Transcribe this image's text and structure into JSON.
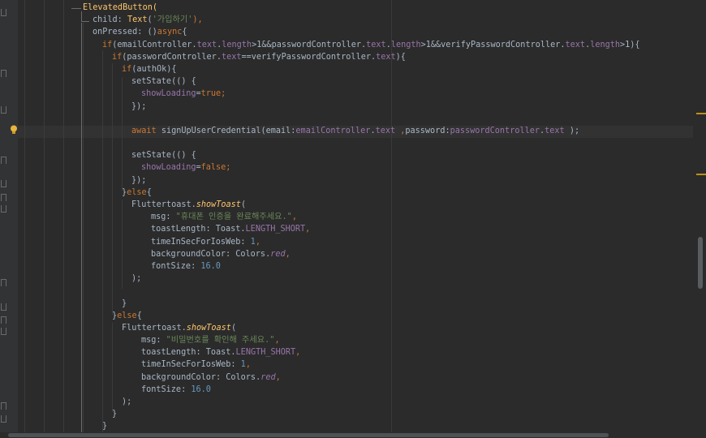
{
  "editor": {
    "lines": [
      [
        {
          "t": "ElevatedButton(",
          "c": "cls"
        }
      ],
      [
        {
          "t": "child",
          "c": "plain"
        },
        {
          "t": ": ",
          "c": "plain"
        },
        {
          "t": "Text",
          "c": "cls"
        },
        {
          "t": "(",
          "c": "plain"
        },
        {
          "t": "'가입하기'",
          "c": "str"
        },
        {
          "t": "),",
          "c": "kw"
        }
      ],
      [
        {
          "t": "onPressed: ()",
          "c": "plain"
        },
        {
          "t": "async",
          "c": "kw"
        },
        {
          "t": "{",
          "c": "plain"
        }
      ],
      [
        {
          "t": "if",
          "c": "kw"
        },
        {
          "t": "(emailController.",
          "c": "plain"
        },
        {
          "t": "text",
          "c": "fld"
        },
        {
          "t": ".",
          "c": "plain"
        },
        {
          "t": "length",
          "c": "fld"
        },
        {
          "t": ">1&&passwordController.",
          "c": "plain"
        },
        {
          "t": "text",
          "c": "fld"
        },
        {
          "t": ".",
          "c": "plain"
        },
        {
          "t": "length",
          "c": "fld"
        },
        {
          "t": ">1&&verifyPasswordController.",
          "c": "plain"
        },
        {
          "t": "text",
          "c": "fld"
        },
        {
          "t": ".",
          "c": "plain"
        },
        {
          "t": "length",
          "c": "fld"
        },
        {
          "t": ">1){",
          "c": "plain"
        }
      ],
      [
        {
          "t": "if",
          "c": "kw"
        },
        {
          "t": "(passwordController.",
          "c": "plain"
        },
        {
          "t": "text",
          "c": "fld"
        },
        {
          "t": "==verifyPasswordController.",
          "c": "plain"
        },
        {
          "t": "text",
          "c": "fld"
        },
        {
          "t": "){",
          "c": "plain"
        }
      ],
      [
        {
          "t": "if",
          "c": "kw"
        },
        {
          "t": "(authOk){",
          "c": "plain"
        }
      ],
      [
        {
          "t": "setState(() {",
          "c": "plain"
        }
      ],
      [
        {
          "t": "showLoading",
          "c": "fld"
        },
        {
          "t": "=",
          "c": "plain"
        },
        {
          "t": "true",
          "c": "kw"
        },
        {
          "t": ";",
          "c": "kw"
        }
      ],
      [
        {
          "t": "});",
          "c": "plain"
        }
      ],
      [],
      [
        {
          "t": "await ",
          "c": "kw"
        },
        {
          "t": "signUpUserCredential(email:",
          "c": "plain"
        },
        {
          "t": "emailController",
          "c": "fld"
        },
        {
          "t": ".",
          "c": "plain"
        },
        {
          "t": "text ",
          "c": "fld"
        },
        {
          "t": ",",
          "c": "kw"
        },
        {
          "t": "password:",
          "c": "plain"
        },
        {
          "t": "passwordController",
          "c": "fld"
        },
        {
          "t": ".",
          "c": "plain"
        },
        {
          "t": "text ",
          "c": "fld"
        },
        {
          "t": ");",
          "c": "plain"
        }
      ],
      [],
      [
        {
          "t": "setState(() {",
          "c": "plain"
        }
      ],
      [
        {
          "t": "showLoading",
          "c": "fld"
        },
        {
          "t": "=",
          "c": "plain"
        },
        {
          "t": "false",
          "c": "kw"
        },
        {
          "t": ";",
          "c": "kw"
        }
      ],
      [
        {
          "t": "});",
          "c": "plain"
        }
      ],
      [
        {
          "t": "}",
          "c": "plain"
        },
        {
          "t": "else",
          "c": "kw"
        },
        {
          "t": "{",
          "c": "plain"
        }
      ],
      [
        {
          "t": "Fluttertoast.",
          "c": "plain"
        },
        {
          "t": "showToast",
          "c": "itm"
        },
        {
          "t": "(",
          "c": "plain"
        }
      ],
      [
        {
          "t": "msg: ",
          "c": "plain"
        },
        {
          "t": "\"휴대폰 인증을 완료해주세요.\"",
          "c": "str"
        },
        {
          "t": ",",
          "c": "kw"
        }
      ],
      [
        {
          "t": "toastLength: Toast.",
          "c": "plain"
        },
        {
          "t": "LENGTH_SHORT",
          "c": "fld"
        },
        {
          "t": ",",
          "c": "kw"
        }
      ],
      [
        {
          "t": "timeInSecForIosWeb: ",
          "c": "plain"
        },
        {
          "t": "1",
          "c": "num"
        },
        {
          "t": ",",
          "c": "kw"
        }
      ],
      [
        {
          "t": "backgroundColor: Colors.",
          "c": "plain"
        },
        {
          "t": "red",
          "c": "itf"
        },
        {
          "t": ",",
          "c": "kw"
        }
      ],
      [
        {
          "t": "fontSize: ",
          "c": "plain"
        },
        {
          "t": "16.0",
          "c": "num"
        }
      ],
      [
        {
          "t": ");",
          "c": "plain"
        }
      ],
      [],
      [
        {
          "t": "}",
          "c": "plain"
        }
      ],
      [
        {
          "t": "}",
          "c": "plain"
        },
        {
          "t": "else",
          "c": "kw"
        },
        {
          "t": "{",
          "c": "plain"
        }
      ],
      [
        {
          "t": "Fluttertoast.",
          "c": "plain"
        },
        {
          "t": "showToast",
          "c": "itm"
        },
        {
          "t": "(",
          "c": "plain"
        }
      ],
      [
        {
          "t": "msg: ",
          "c": "plain"
        },
        {
          "t": "\"비밀번호를 확인해 주세요.\"",
          "c": "str"
        },
        {
          "t": ",",
          "c": "kw"
        }
      ],
      [
        {
          "t": "toastLength: Toast.",
          "c": "plain"
        },
        {
          "t": "LENGTH_SHORT",
          "c": "fld"
        },
        {
          "t": ",",
          "c": "kw"
        }
      ],
      [
        {
          "t": "timeInSecForIosWeb: ",
          "c": "plain"
        },
        {
          "t": "1",
          "c": "num"
        },
        {
          "t": ",",
          "c": "kw"
        }
      ],
      [
        {
          "t": "backgroundColor: Colors.",
          "c": "plain"
        },
        {
          "t": "red",
          "c": "itf"
        },
        {
          "t": ",",
          "c": "kw"
        }
      ],
      [
        {
          "t": "fontSize: ",
          "c": "plain"
        },
        {
          "t": "16.0",
          "c": "num"
        }
      ],
      [
        {
          "t": ");",
          "c": "plain"
        }
      ],
      [
        {
          "t": "}",
          "c": "plain"
        }
      ],
      [
        {
          "t": "}",
          "c": "plain"
        }
      ]
    ],
    "indents": [
      80,
      92,
      92,
      104,
      116,
      128,
      140,
      152,
      140,
      0,
      140,
      0,
      140,
      152,
      140,
      128,
      140,
      164,
      164,
      164,
      164,
      164,
      140,
      0,
      128,
      116,
      128,
      152,
      152,
      152,
      152,
      152,
      128,
      116,
      104
    ],
    "current_line_index": 10,
    "icons": {
      "intention": "lightbulb-icon"
    },
    "colors": {
      "background": "#2b2b2b",
      "keyword": "#cc7832",
      "class": "#ffc66d",
      "field": "#9876aa",
      "string": "#6a8759",
      "number": "#6897bb",
      "text": "#a9b7c6"
    }
  }
}
